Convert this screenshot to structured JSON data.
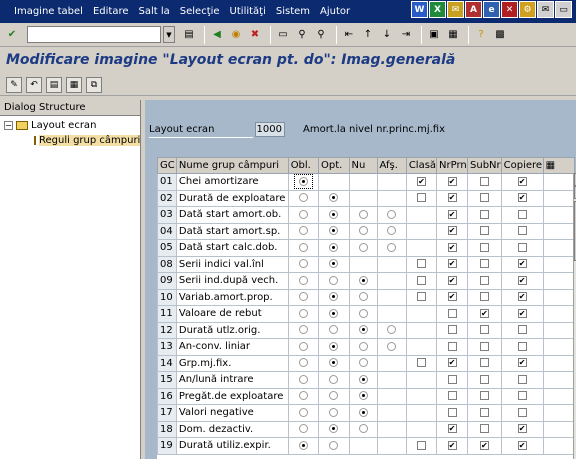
{
  "menu": [
    "Imagine tabel",
    "Editare",
    "Salt la",
    "Selecţie",
    "Utilităţi",
    "Sistem",
    "Ajutor"
  ],
  "title": "Modificare imagine \"Layout ecran pt. do\": Imag.generală",
  "tree": {
    "header": "Dialog Structure",
    "root": "Layout ecran",
    "child": "Reguli grup câmpuri"
  },
  "layout": {
    "label": "Layout ecran",
    "value": "1000",
    "description": "Amort.la nivel nr.princ.mj.fix"
  },
  "table": {
    "headers": [
      "GC",
      "Nume grup câmpuri",
      "Obl.",
      "Opt.",
      "Nu",
      "Afş.",
      "Clasă",
      "NrPrn",
      "SubNr",
      "Copiere"
    ],
    "rows": [
      {
        "gc": "01",
        "name": "Chei amortizare",
        "obl": "on",
        "opt": "",
        "nu": "",
        "afs": "",
        "clasa": true,
        "nrprn": true,
        "subnr": false,
        "copiere": true
      },
      {
        "gc": "02",
        "name": "Durată de exploatare",
        "obl": "off",
        "opt": "on",
        "nu": "",
        "afs": "",
        "clasa": false,
        "nrprn": true,
        "subnr": false,
        "copiere": true
      },
      {
        "gc": "03",
        "name": "Dată start amort.ob.",
        "obl": "off",
        "opt": "on",
        "nu": "off",
        "afs": "off",
        "clasa": null,
        "nrprn": true,
        "subnr": false,
        "copiere": false
      },
      {
        "gc": "04",
        "name": "Dată start amort.sp.",
        "obl": "off",
        "opt": "on",
        "nu": "off",
        "afs": "off",
        "clasa": null,
        "nrprn": true,
        "subnr": false,
        "copiere": false
      },
      {
        "gc": "05",
        "name": "Dată start calc.dob.",
        "obl": "off",
        "opt": "on",
        "nu": "off",
        "afs": "off",
        "clasa": null,
        "nrprn": true,
        "subnr": false,
        "copiere": false
      },
      {
        "gc": "08",
        "name": "Serii indici val.înl",
        "obl": "off",
        "opt": "on",
        "nu": "",
        "afs": "",
        "clasa": false,
        "nrprn": true,
        "subnr": false,
        "copiere": true
      },
      {
        "gc": "09",
        "name": "Serii ind.după vech.",
        "obl": "off",
        "opt": "off",
        "nu": "on",
        "afs": "",
        "clasa": false,
        "nrprn": true,
        "subnr": false,
        "copiere": true
      },
      {
        "gc": "10",
        "name": "Variab.amort.prop.",
        "obl": "off",
        "opt": "on",
        "nu": "off",
        "afs": "",
        "clasa": false,
        "nrprn": true,
        "subnr": false,
        "copiere": true
      },
      {
        "gc": "11",
        "name": "Valoare de rebut",
        "obl": "off",
        "opt": "on",
        "nu": "off",
        "afs": "",
        "clasa": null,
        "nrprn": false,
        "subnr": true,
        "copiere": true
      },
      {
        "gc": "12",
        "name": "Durată utlz.orig.",
        "obl": "off",
        "opt": "off",
        "nu": "on",
        "afs": "off",
        "clasa": null,
        "nrprn": false,
        "subnr": false,
        "copiere": false
      },
      {
        "gc": "13",
        "name": "An-conv. liniar",
        "obl": "off",
        "opt": "on",
        "nu": "off",
        "afs": "off",
        "clasa": null,
        "nrprn": false,
        "subnr": false,
        "copiere": false
      },
      {
        "gc": "14",
        "name": "Grp.mj.fix.",
        "obl": "off",
        "opt": "on",
        "nu": "off",
        "afs": "",
        "clasa": false,
        "nrprn": true,
        "subnr": false,
        "copiere": true
      },
      {
        "gc": "15",
        "name": "An/lună intrare",
        "obl": "off",
        "opt": "off",
        "nu": "on",
        "afs": "",
        "clasa": null,
        "nrprn": false,
        "subnr": false,
        "copiere": false
      },
      {
        "gc": "16",
        "name": "Pregăt.de exploatare",
        "obl": "off",
        "opt": "off",
        "nu": "on",
        "afs": "",
        "clasa": null,
        "nrprn": false,
        "subnr": false,
        "copiere": false
      },
      {
        "gc": "17",
        "name": "Valori negative",
        "obl": "off",
        "opt": "off",
        "nu": "on",
        "afs": "",
        "clasa": null,
        "nrprn": false,
        "subnr": false,
        "copiere": false
      },
      {
        "gc": "18",
        "name": "Dom. dezactiv.",
        "obl": "off",
        "opt": "on",
        "nu": "off",
        "afs": "",
        "clasa": null,
        "nrprn": true,
        "subnr": false,
        "copiere": true
      },
      {
        "gc": "19",
        "name": "Durată utiliz.expir.",
        "obl": "on",
        "opt": "off",
        "nu": "",
        "afs": "",
        "clasa": false,
        "nrprn": true,
        "subnr": true,
        "copiere": true
      }
    ]
  },
  "colors": {
    "menubar": "#0b2a70",
    "title": "#1c3b84",
    "main_bg": "#a6b8ca",
    "tree_selected": "#f3dea4"
  },
  "icons": {
    "std": [
      "save-icon",
      "back-icon",
      "exit-icon",
      "cancel-icon",
      "print-icon",
      "find-icon",
      "find-next-icon",
      "first-page-icon",
      "prev-page-icon",
      "next-page-icon",
      "last-page-icon",
      "new-session-icon",
      "shortcut-icon",
      "help-icon",
      "layout-icon"
    ],
    "app": [
      "change-icon",
      "undo-icon",
      "select-all-icon",
      "save-variant-icon",
      "copy-icon"
    ]
  }
}
